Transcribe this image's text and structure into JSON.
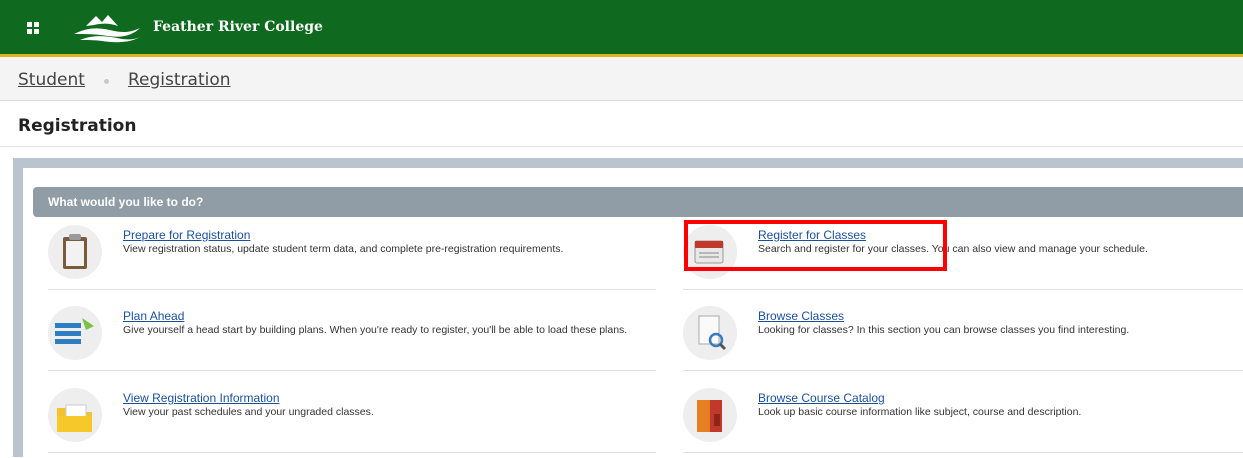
{
  "header": {
    "college_name": "Feather River College",
    "bar_color": "#0f6a1f",
    "accent_color": "#d9b619"
  },
  "breadcrumb": {
    "items": [
      "Student",
      "Registration"
    ]
  },
  "page": {
    "title": "Registration"
  },
  "panel": {
    "header": "What would you like to do?",
    "items": [
      {
        "label": "Prepare for Registration",
        "description": "View registration status, update student term data, and complete pre-registration requirements.",
        "icon": "clipboard-icon"
      },
      {
        "label": "Register for Classes",
        "description": "Search and register for your classes. You can also view and manage your schedule.",
        "icon": "calendar-icon"
      },
      {
        "label": "Plan Ahead",
        "description": "Give yourself a head start by building plans. When you're ready to register, you'll be able to load these plans.",
        "icon": "plan-list-icon"
      },
      {
        "label": "Browse Classes",
        "description": "Looking for classes? In this section you can browse classes you find interesting.",
        "icon": "document-search-icon"
      },
      {
        "label": "View Registration Information",
        "description": "View your past schedules and your ungraded classes.",
        "icon": "folder-icon"
      },
      {
        "label": "Browse Course Catalog",
        "description": "Look up basic course information like subject, course and description.",
        "icon": "book-icon"
      }
    ]
  },
  "annotation": {
    "highlight_color": "#ff0000"
  }
}
